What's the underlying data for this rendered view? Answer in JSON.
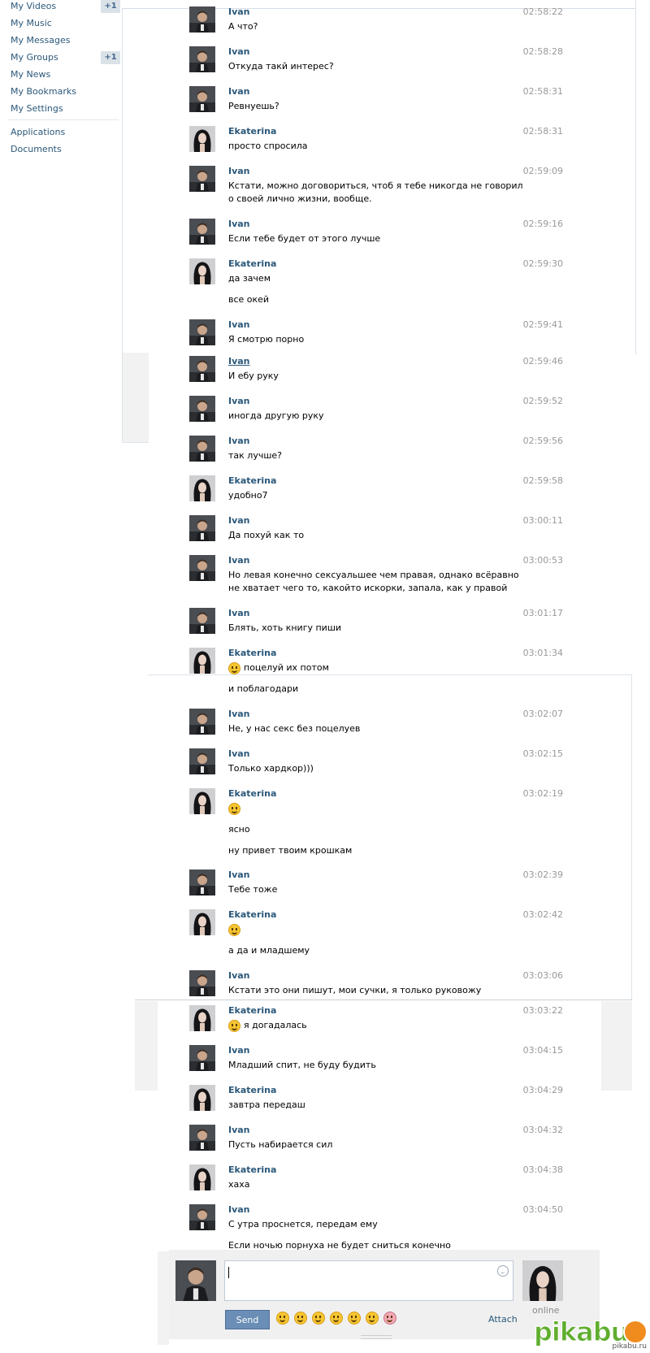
{
  "sidebar": {
    "items": [
      {
        "label": "My Videos",
        "badge": "+1"
      },
      {
        "label": "My Music",
        "badge": ""
      },
      {
        "label": "My Messages",
        "badge": ""
      },
      {
        "label": "My Groups",
        "badge": "+1"
      },
      {
        "label": "My News",
        "badge": ""
      },
      {
        "label": "My Bookmarks",
        "badge": ""
      },
      {
        "label": "My Settings",
        "badge": ""
      }
    ],
    "extra": [
      {
        "label": "Applications"
      },
      {
        "label": "Documents"
      }
    ]
  },
  "messages": [
    {
      "author": "Ivan",
      "time": "02:58:22",
      "lines": [
        "А что?"
      ]
    },
    {
      "author": "Ivan",
      "time": "02:58:28",
      "lines": [
        "Откуда такй интерес?"
      ]
    },
    {
      "author": "Ivan",
      "time": "02:58:31",
      "lines": [
        "Ревнуешь?"
      ]
    },
    {
      "author": "Ekaterina",
      "time": "02:58:31",
      "lines": [
        "просто спросила"
      ]
    },
    {
      "author": "Ivan",
      "time": "02:59:09",
      "lines": [
        "Кстати, можно договориться, чтоб я тебе никогда не говорил о своей лично жизни, вообще."
      ]
    },
    {
      "author": "Ivan",
      "time": "02:59:16",
      "lines": [
        "Если тебе будет от этого лучше"
      ]
    },
    {
      "author": "Ekaterina",
      "time": "02:59:30",
      "lines": [
        "да зачем",
        "все окей"
      ]
    },
    {
      "author": "Ivan",
      "time": "02:59:41",
      "lines": [
        "Я смотрю порно"
      ]
    },
    {
      "author": "Ivan",
      "time": "02:59:46",
      "lines": [
        "И ебу руку"
      ]
    },
    {
      "author": "Ivan",
      "time": "02:59:52",
      "lines": [
        "иногда другую руку"
      ]
    },
    {
      "author": "Ivan",
      "time": "02:59:56",
      "lines": [
        "так лучше?"
      ]
    },
    {
      "author": "Ekaterina",
      "time": "02:59:58",
      "lines": [
        "удобно7"
      ]
    },
    {
      "author": "Ivan",
      "time": "03:00:11",
      "lines": [
        "Да похуй как то"
      ]
    },
    {
      "author": "Ivan",
      "time": "03:00:53",
      "lines": [
        "Но левая конечно сексуальшее чем правая, однако всёравно не хватает чего то, какойто искорки, запала, как у правой"
      ]
    },
    {
      "author": "Ivan",
      "time": "03:01:17",
      "lines": [
        "Блять, хоть книгу пиши"
      ]
    },
    {
      "author": "Ekaterina",
      "time": "03:01:34",
      "lines": [
        "поцелуй их потом",
        "и поблагодари"
      ]
    },
    {
      "author": "Ivan",
      "time": "03:02:07",
      "lines": [
        "Не, у нас секс без поцелуев"
      ]
    },
    {
      "author": "Ivan",
      "time": "03:02:15",
      "lines": [
        "Только хардкор)))"
      ]
    },
    {
      "author": "Ekaterina",
      "time": "03:02:19",
      "lines": [
        "",
        "ясно",
        "ну привет твоим крошкам"
      ]
    },
    {
      "author": "Ivan",
      "time": "03:02:39",
      "lines": [
        "Тебе тоже"
      ]
    },
    {
      "author": "Ekaterina",
      "time": "03:02:42",
      "lines": [
        "",
        "а да и младшему"
      ]
    },
    {
      "author": "Ivan",
      "time": "03:03:06",
      "lines": [
        "Кстати это они пишут, мои сучки, я только руковожу"
      ]
    },
    {
      "author": "Ekaterina",
      "time": "03:03:22",
      "lines": [
        "я догадалась"
      ]
    },
    {
      "author": "Ivan",
      "time": "03:04:15",
      "lines": [
        "Младший спит, не буду будить"
      ]
    },
    {
      "author": "Ekaterina",
      "time": "03:04:29",
      "lines": [
        "завтра передаш"
      ]
    },
    {
      "author": "Ivan",
      "time": "03:04:32",
      "lines": [
        "Пусть набирается сил"
      ]
    },
    {
      "author": "Ekaterina",
      "time": "03:04:38",
      "lines": [
        "хаха"
      ]
    },
    {
      "author": "Ivan",
      "time": "03:04:50",
      "lines": [
        "С утра проснется, передам ему",
        "Если ночью порнуха не будет сниться конечно"
      ]
    }
  ],
  "composer": {
    "send_label": "Send",
    "attach_label": "Attach",
    "status": "online",
    "emoji_icons": [
      "smile-icon",
      "grin-icon",
      "laugh-icon",
      "wink-icon",
      "sad-icon",
      "happy-icon",
      "pig-icon"
    ]
  },
  "watermark": {
    "brand": "pikabu",
    "site": "pikabu.ru"
  },
  "colors": {
    "link": "#2b587a",
    "time": "#999999",
    "send_button": "#6a8eb5",
    "badge_bg": "#dae2e8"
  }
}
